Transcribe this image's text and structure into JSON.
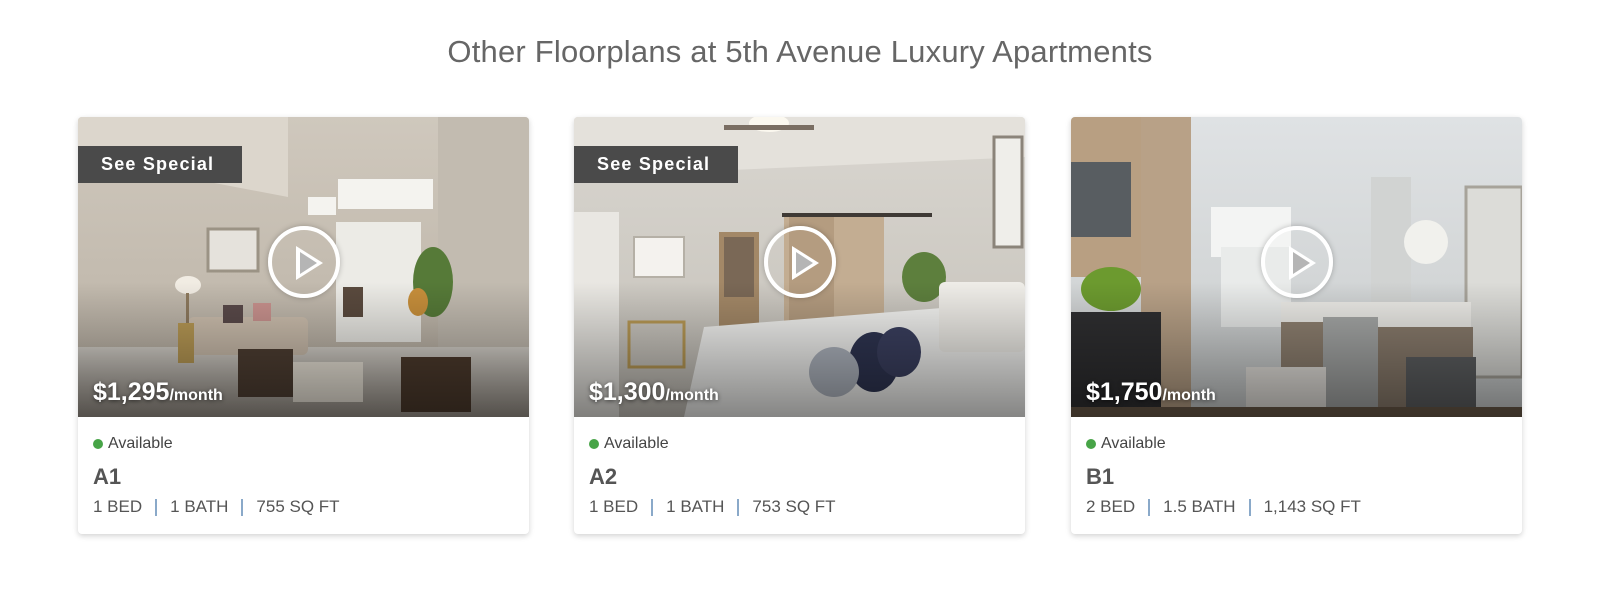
{
  "section": {
    "title": "Other Floorplans at 5th Avenue Luxury Apartments"
  },
  "colors": {
    "available_dot": "#47a447",
    "separator": "#8aa9c9",
    "badge_bg": "#4a4a4a"
  },
  "cards": [
    {
      "badge": "See Special",
      "price": "$1,295",
      "per": "/month",
      "status": "Available",
      "name": "A1",
      "beds": "1 BED",
      "baths": "1 BATH",
      "sqft": "755 SQ FT",
      "photo": "living-room-photo"
    },
    {
      "badge": "See Special",
      "price": "$1,300",
      "per": "/month",
      "status": "Available",
      "name": "A2",
      "beds": "1 BED",
      "baths": "1 BATH",
      "sqft": "753 SQ FT",
      "photo": "bedroom-photo"
    },
    {
      "badge": "",
      "price": "$1,750",
      "per": "/month",
      "status": "Available",
      "name": "B1",
      "beds": "2 BED",
      "baths": "1.5 BATH",
      "sqft": "1,143 SQ FT",
      "photo": "kitchen-photo"
    }
  ]
}
